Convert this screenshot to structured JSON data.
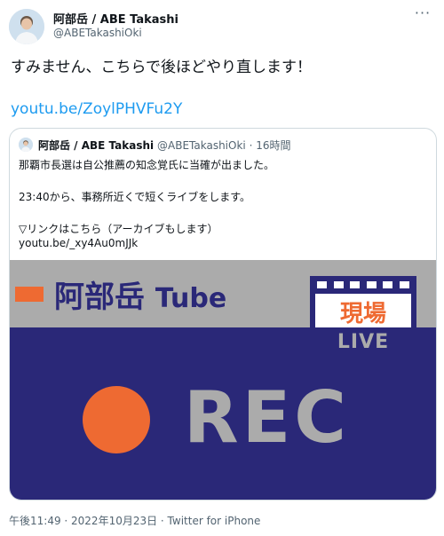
{
  "author": {
    "name": "阿部岳 / ABE Takashi",
    "handle": "@ABETakashiOki"
  },
  "tweet": {
    "text": "すみません、こちらで後ほどやり直します！",
    "link": "youtu.be/ZoylPHVFu2Y"
  },
  "quote": {
    "name": "阿部岳 / ABE Takashi",
    "handle": "@ABETakashiOki",
    "time": "16時間",
    "lines": [
      "那覇市長選は自公推薦の知念覚氏に当確が出ました。",
      "23:40から、事務所近くで短くライブをします。",
      "▽リンクはこちら（アーカイブもします）",
      "youtu.be/_xy4Au0mJJk"
    ]
  },
  "thumbnail": {
    "title": "阿部岳",
    "title_suffix": "Tube",
    "badge_kanji": "現場",
    "badge_live": "LIVE",
    "rec": "REC"
  },
  "footer": {
    "meta": "午後11:49 · 2022年10月23日 · Twitter for iPhone"
  },
  "colors": {
    "link": "#1d9bf0",
    "navy": "#2a2878",
    "orange": "#ee6a32",
    "grey": "#ababab"
  },
  "icons": {
    "more": "more-horizontal-icon"
  }
}
